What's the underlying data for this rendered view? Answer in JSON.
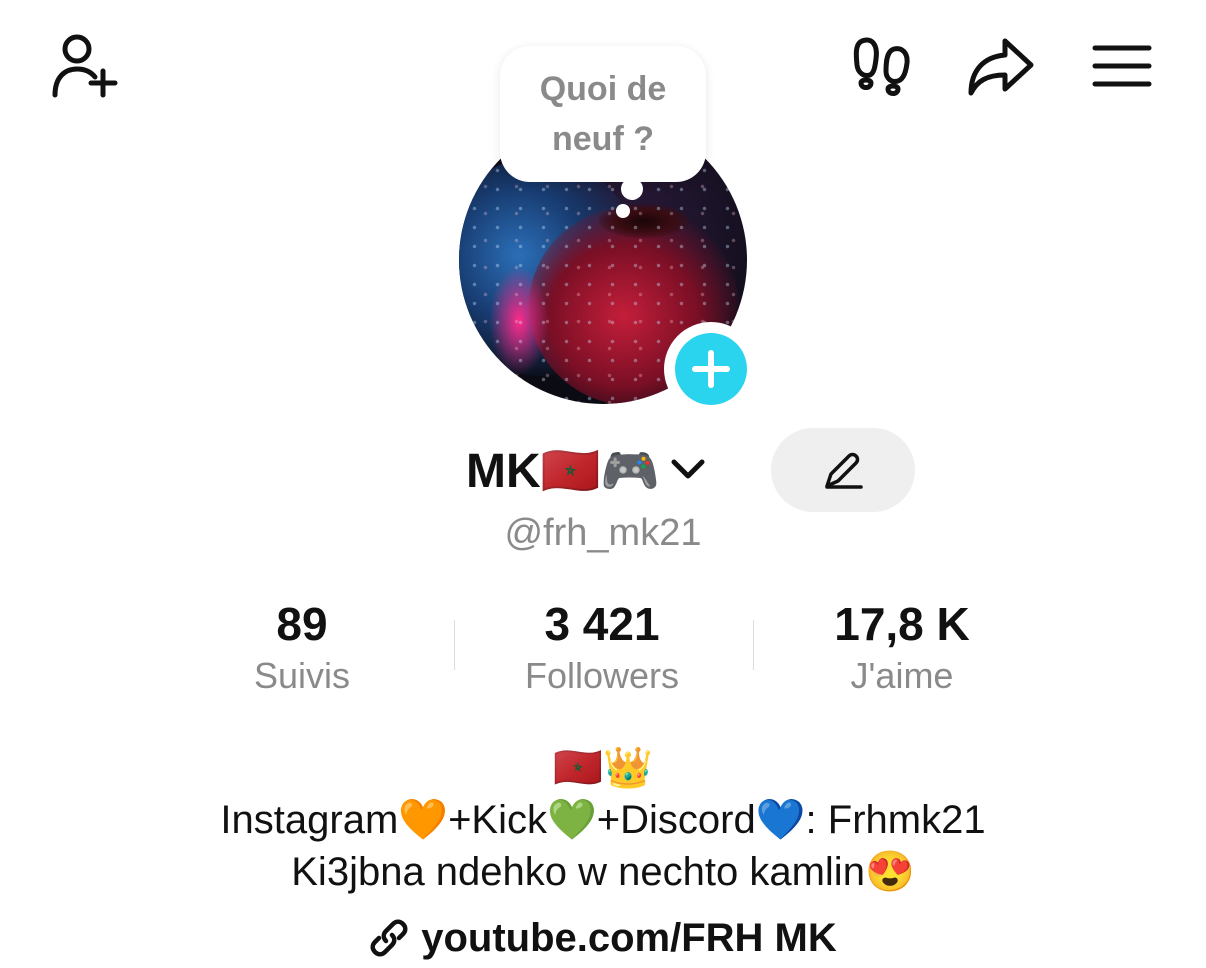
{
  "header": {
    "icons": [
      "add-friend-icon",
      "footprints-icon",
      "share-icon",
      "menu-icon"
    ]
  },
  "bubble": {
    "text": "Quoi de neuf ?"
  },
  "profile": {
    "display_name": "MK🇲🇦🎮",
    "username": "@frh_mk21",
    "edit_icon": "pencil-icon",
    "accent_color": "#2bd4ee"
  },
  "stats": [
    {
      "value": "89",
      "label": "Suivis"
    },
    {
      "value": "3 421",
      "label": "Followers"
    },
    {
      "value": "17,8 K",
      "label": "J'aime"
    }
  ],
  "bio": {
    "lines": [
      "🇲🇦👑",
      "Instagram🧡+Kick💚+Discord💙: Frhmk21",
      "Ki3jbna ndehko w nechto kamlin😍"
    ]
  },
  "link": {
    "icon": "link-icon",
    "text": "youtube.com/FRH MK"
  }
}
